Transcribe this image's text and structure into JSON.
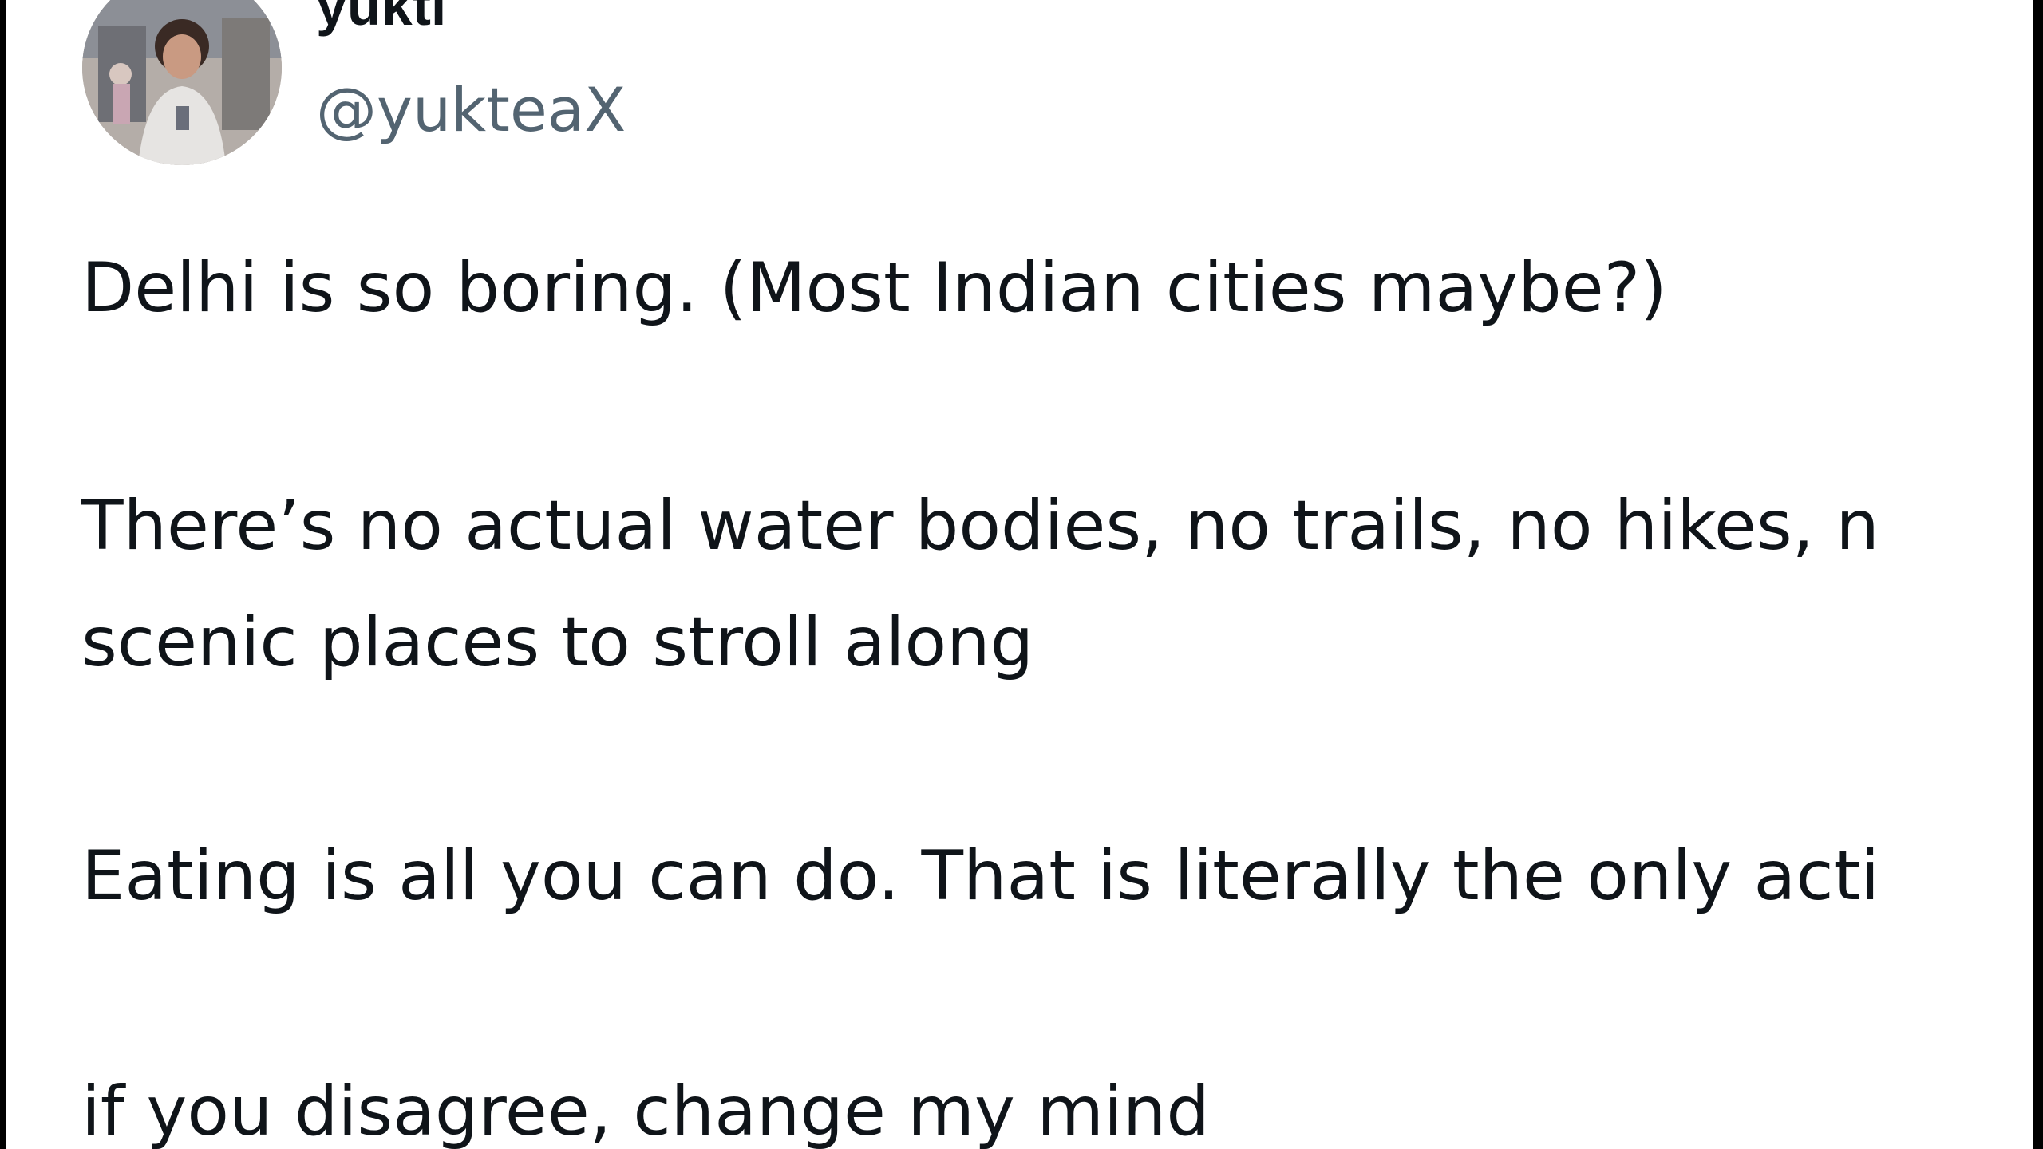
{
  "author": {
    "display_name": "yukti",
    "handle": "@yukteaX",
    "avatar_icon": "profile-photo"
  },
  "tweet": {
    "lines": [
      "Delhi is so boring. (Most Indian cities maybe?)",
      "There’s no actual water bodies, no trails, no hikes, n",
      "scenic places to stroll along",
      "Eating is all you can do. That is literally the only acti",
      "if you disagree, change my mind"
    ]
  },
  "colors": {
    "text_primary": "#0f1419",
    "text_secondary": "#536471",
    "background": "#ffffff",
    "frame": "#000000"
  }
}
